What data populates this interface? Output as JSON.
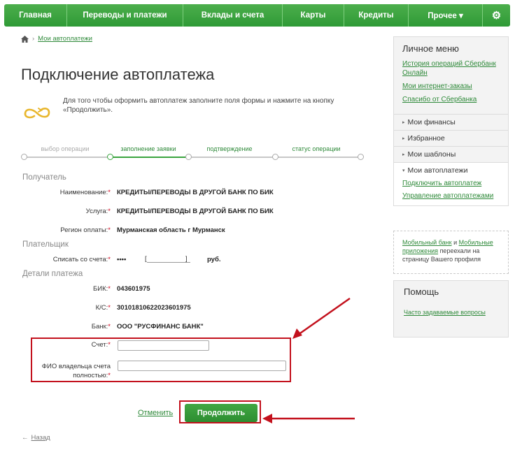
{
  "nav": {
    "items": [
      "Главная",
      "Переводы и платежи",
      "Вклады и счета",
      "Карты",
      "Кредиты",
      "Прочее ▾"
    ],
    "settings_icon": "gear-icon",
    "accent_color": "#3aa43f"
  },
  "breadcrumb": {
    "home_icon": "home-icon",
    "link": "Мои автоплатежи"
  },
  "page": {
    "title": "Подключение автоплатежа",
    "intro_icon": "infinity-icon",
    "intro_text": "Для того чтобы оформить автоплатеж заполните поля формы и нажмите на кнопку «Продолжить»."
  },
  "steps": [
    {
      "label": "выбор операции",
      "state": "done"
    },
    {
      "label": "заполнение заявки",
      "state": "current"
    },
    {
      "label": "подтверждение",
      "state": "pending"
    },
    {
      "label": "статус операции",
      "state": "pending"
    }
  ],
  "sections": {
    "recipient": "Получатель",
    "payer": "Плательщик",
    "details": "Детали платежа"
  },
  "recipient": {
    "name_label": "Наименование:",
    "name_value": "КРЕДИТЫ/ПЕРЕВОДЫ В ДРУГОЙ БАНК ПО БИК",
    "service_label": "Услуга:",
    "service_value": "КРЕДИТЫ/ПЕРЕВОДЫ В ДРУГОЙ БАНК ПО БИК",
    "region_label": "Регион оплаты:",
    "region_value": "Мурманская область г Мурманск"
  },
  "payer": {
    "account_label": "Списать со счета:",
    "account_mask": "••••",
    "bracket_open": "[",
    "bracket_close": "]",
    "currency": "руб."
  },
  "details": {
    "bik_label": "БИК:",
    "bik_value": "043601975",
    "ks_label": "К/С:",
    "ks_value": "30101810622023601975",
    "bank_label": "Банк:",
    "bank_value": "ООО \"РУСФИНАНС БАНК\"",
    "account_label": "Счет:",
    "account_value": "",
    "owner_label_1": "ФИО владельца счета",
    "owner_label_2": "полностью:",
    "owner_value": ""
  },
  "required_mark": "*",
  "actions": {
    "cancel": "Отменить",
    "continue": "Продолжить"
  },
  "back": {
    "arrow": "←",
    "label": "Назад"
  },
  "sidebar": {
    "title": "Личное меню",
    "links": [
      "История операций Сбербанк Онлайн",
      "Мои интернет-заказы",
      "Спасибо от Сбербанка"
    ],
    "items": [
      "Мои финансы",
      "Избранное",
      "Мои шаблоны"
    ],
    "active_item": "Мои автоплатежи",
    "active_subitems": [
      "Подключить автоплатеж",
      "Управление автоплатежами"
    ]
  },
  "note": {
    "link1": "Мобильный банк",
    "and": " и ",
    "link2": "Мобильные приложения",
    "rest": " переехали на страницу Вашего профиля"
  },
  "help": {
    "title": "Помощь",
    "link": "Часто задаваемые вопросы"
  },
  "colors": {
    "highlight_red": "#c3111d",
    "link_green": "#2f8a3a"
  }
}
